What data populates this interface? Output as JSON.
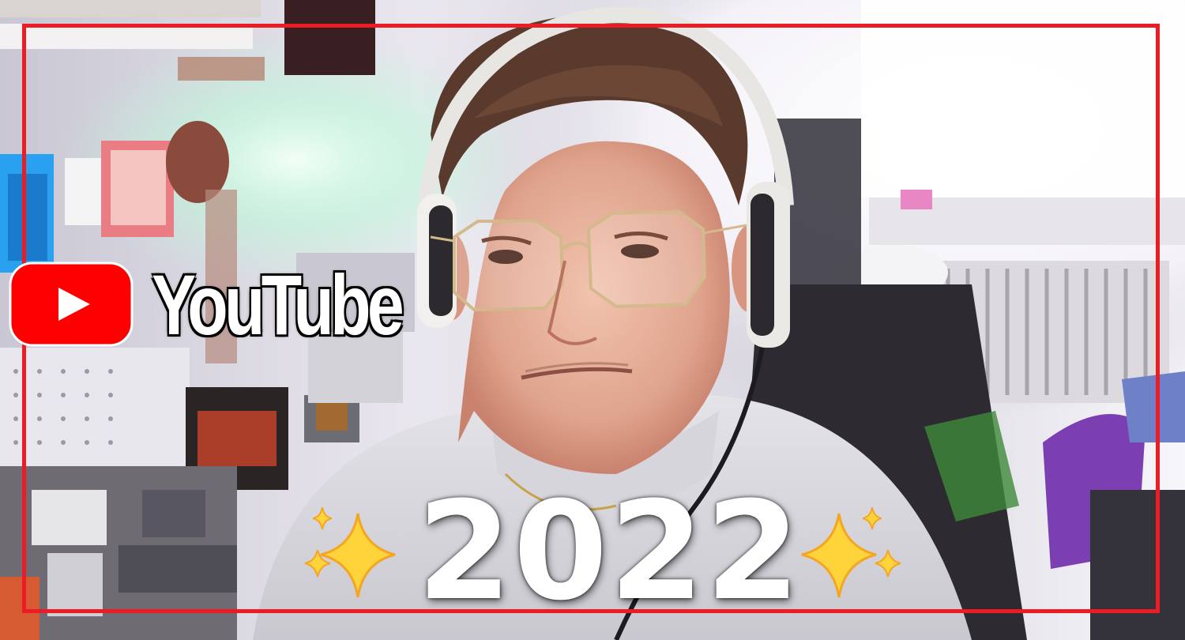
{
  "thumbnail": {
    "brand_text": "YouTube",
    "year_text": "2022",
    "icons": {
      "brand_logo": "youtube-play-icon",
      "sparkles": "sparkles-icon"
    },
    "colors": {
      "frame": "#ec1c24",
      "youtube_red": "#ff0000",
      "sparkle": "#ffd43b",
      "text": "#ffffff"
    }
  }
}
